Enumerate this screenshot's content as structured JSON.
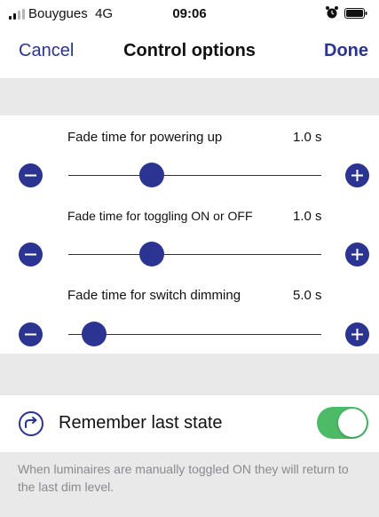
{
  "status_bar": {
    "carrier": "Bouygues",
    "network": "4G",
    "time": "09:06",
    "signal_bars": 2,
    "icons": [
      "signal-icon",
      "alarm-icon",
      "battery-icon"
    ]
  },
  "nav": {
    "cancel_label": "Cancel",
    "title": "Control options",
    "done_label": "Done"
  },
  "sliders": [
    {
      "label": "Fade time for powering up",
      "value_text": "1.0 s",
      "value_fraction": 0.33,
      "decrement_icon": "minus-icon",
      "increment_icon": "plus-icon"
    },
    {
      "label": "Fade time for toggling ON or OFF",
      "value_text": "1.0 s",
      "value_fraction": 0.33,
      "decrement_icon": "minus-icon",
      "increment_icon": "plus-icon"
    },
    {
      "label": "Fade time for switch dimming",
      "value_text": "5.0 s",
      "value_fraction": 0.1,
      "decrement_icon": "minus-icon",
      "increment_icon": "plus-icon"
    }
  ],
  "remember": {
    "label": "Remember last state",
    "icon": "redo-arrow-icon",
    "enabled": true,
    "description": "When luminaires are manually toggled ON they will return to the last dim level."
  },
  "colors": {
    "accent": "#2b3490",
    "toggle_on": "#4cba67",
    "section_gray": "#e9e9ea",
    "footer_text": "#8a8a8e"
  }
}
